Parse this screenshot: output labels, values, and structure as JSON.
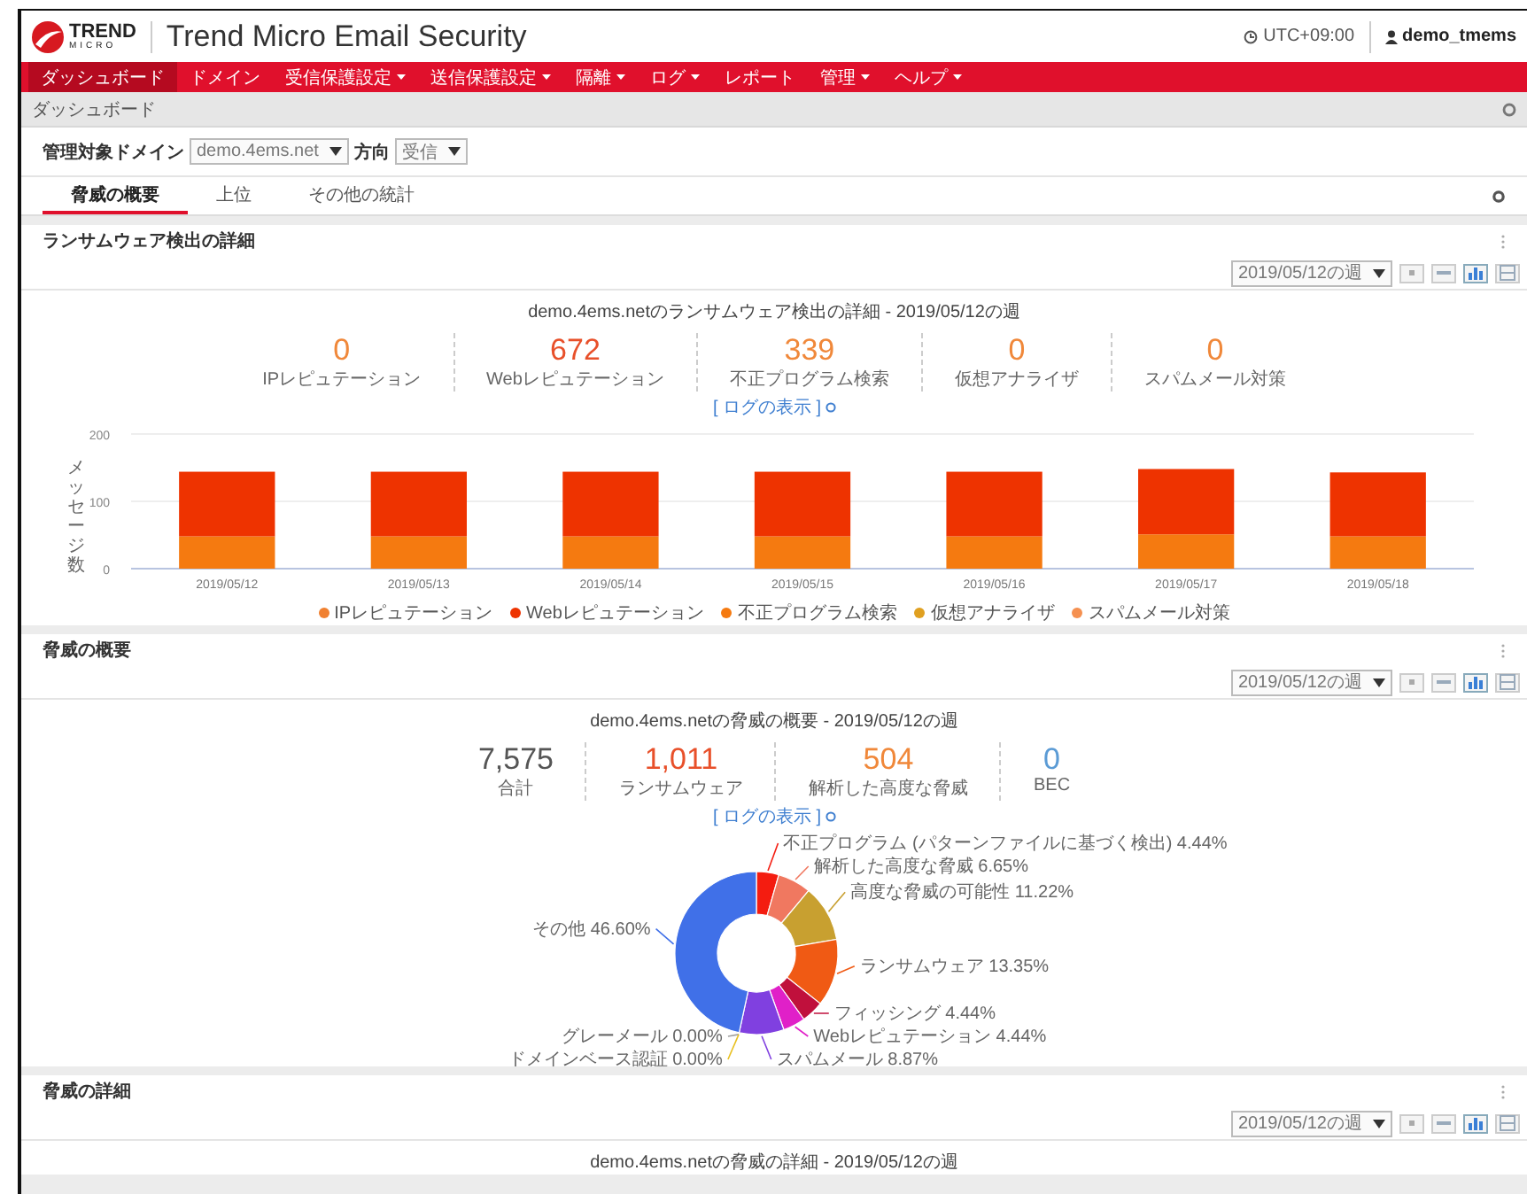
{
  "header": {
    "logo_text": "TREND",
    "logo_subtext": "MICRO",
    "title": "Trend Micro Email Security",
    "timezone": "UTC+09:00",
    "user": "demo_tmems"
  },
  "nav": [
    {
      "label": "ダッシュボード",
      "selected": true,
      "dropdown": false
    },
    {
      "label": "ドメイン",
      "selected": false,
      "dropdown": false
    },
    {
      "label": "受信保護設定",
      "selected": false,
      "dropdown": true
    },
    {
      "label": "送信保護設定",
      "selected": false,
      "dropdown": true
    },
    {
      "label": "隔離",
      "selected": false,
      "dropdown": true
    },
    {
      "label": "ログ",
      "selected": false,
      "dropdown": true
    },
    {
      "label": "レポート",
      "selected": false,
      "dropdown": false
    },
    {
      "label": "管理",
      "selected": false,
      "dropdown": true
    },
    {
      "label": "ヘルプ",
      "selected": false,
      "dropdown": true
    }
  ],
  "breadcrumb": "ダッシュボード",
  "filters": {
    "domain_label": "管理対象ドメイン",
    "domain_value": "demo.4ems.net",
    "direction_label": "方向",
    "direction_value": "受信"
  },
  "tabs": [
    {
      "label": "脅威の概要",
      "selected": true
    },
    {
      "label": "上位",
      "selected": false
    },
    {
      "label": "その他の統計",
      "selected": false
    }
  ],
  "panels": [
    {
      "title": "ランサムウェア検出の詳細",
      "week": "2019/05/12の週",
      "chart_title": "demo.4ems.netのランサムウェア検出の詳細 - 2019/05/12の週",
      "log_link": "[ ログの表示 ]",
      "stats": [
        {
          "value": "0",
          "label": "IPレピュテーション",
          "color": "#f0883a"
        },
        {
          "value": "672",
          "label": "Webレピュテーション",
          "color": "#e8502a"
        },
        {
          "value": "339",
          "label": "不正プログラム検索",
          "color": "#f0883a"
        },
        {
          "value": "0",
          "label": "仮想アナライザ",
          "color": "#f0883a"
        },
        {
          "value": "0",
          "label": "スパムメール対策",
          "color": "#f0883a"
        }
      ],
      "chart_data": {
        "type": "bar",
        "stacked": true,
        "legend": "bottom",
        "ylabel": "メッセージ数",
        "ylim": [
          0,
          200
        ],
        "yticks": [
          0,
          100,
          200
        ],
        "categories": [
          "2019/05/12",
          "2019/05/13",
          "2019/05/14",
          "2019/05/15",
          "2019/05/16",
          "2019/05/17",
          "2019/05/18"
        ],
        "series": [
          {
            "name": "IPレピュテーション",
            "color": "#f08030",
            "values": [
              0,
              0,
              0,
              0,
              0,
              0,
              0
            ]
          },
          {
            "name": "Webレピュテーション",
            "color": "#ee3300",
            "values": [
              96,
              96,
              96,
              96,
              96,
              97,
              95
            ]
          },
          {
            "name": "不正プログラム検索",
            "color": "#f57a10",
            "values": [
              48,
              48,
              48,
              48,
              48,
              51,
              48
            ]
          },
          {
            "name": "仮想アナライザ",
            "color": "#e0a020",
            "values": [
              0,
              0,
              0,
              0,
              0,
              0,
              0
            ]
          },
          {
            "name": "スパムメール対策",
            "color": "#f59050",
            "values": [
              0,
              0,
              0,
              0,
              0,
              0,
              0
            ]
          }
        ]
      }
    },
    {
      "title": "脅威の概要",
      "week": "2019/05/12の週",
      "chart_title": "demo.4ems.netの脅威の概要 - 2019/05/12の週",
      "log_link": "[ ログの表示 ]",
      "stats": [
        {
          "value": "7,575",
          "label": "合計",
          "color": "#555555"
        },
        {
          "value": "1,011",
          "label": "ランサムウェア",
          "color": "#e8502a"
        },
        {
          "value": "504",
          "label": "解析した高度な脅威",
          "color": "#f0883a"
        },
        {
          "value": "0",
          "label": "BEC",
          "color": "#5b9bd5"
        }
      ],
      "chart_data": {
        "type": "donut",
        "value_labels": [
          "4.44%",
          "6.65%",
          "11.22%",
          "13.35%",
          "4.44%",
          "4.44%",
          "8.87%",
          "0.00%",
          "0.00%",
          "46.60%"
        ],
        "categories": [
          "不正プログラム (パターンファイルに基づく検出)",
          "解析した高度な脅威",
          "高度な脅威の可能性",
          "ランサムウェア",
          "フィッシング",
          "Webレピュテーション",
          "スパムメール",
          "グレーメール",
          "ドメインベース認証",
          "その他"
        ],
        "values": [
          4.44,
          6.65,
          11.22,
          13.35,
          4.44,
          4.44,
          8.87,
          0,
          0,
          46.6
        ],
        "colors": [
          "#f41c10",
          "#f07860",
          "#c8a030",
          "#f05a14",
          "#c0103c",
          "#e020c8",
          "#8040e0",
          "#a0a0a0",
          "#e8c020",
          "#4070e8"
        ]
      }
    },
    {
      "title": "脅威の詳細",
      "week": "2019/05/12の週",
      "chart_title": "demo.4ems.netの脅威の詳細 - 2019/05/12の週"
    }
  ],
  "view_buttons": [
    {
      "kind": "export",
      "selected": false
    },
    {
      "kind": "line",
      "selected": false
    },
    {
      "kind": "bar",
      "selected": true
    },
    {
      "kind": "table",
      "selected": false
    }
  ]
}
